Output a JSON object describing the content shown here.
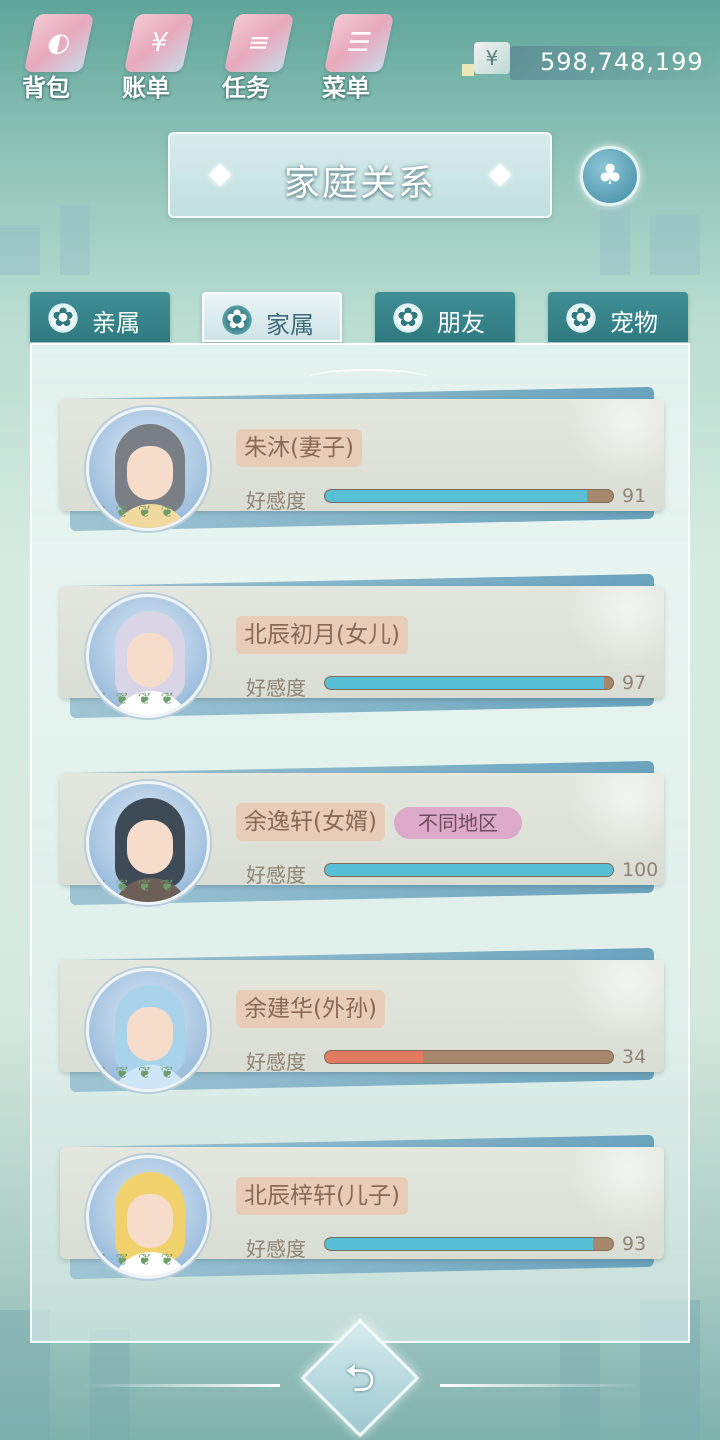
{
  "nav": [
    {
      "label": "背包",
      "icon": "backpack-icon",
      "glyph": "◐"
    },
    {
      "label": "账单",
      "icon": "bill-icon",
      "glyph": "¥"
    },
    {
      "label": "任务",
      "icon": "task-icon",
      "glyph": "≡"
    },
    {
      "label": "菜单",
      "icon": "menu-icon",
      "glyph": "☰"
    }
  ],
  "currency": {
    "symbol": "¥",
    "amount": "598,748,199"
  },
  "title": "家庭关系",
  "tabs": [
    {
      "label": "亲属",
      "active": false
    },
    {
      "label": "家属",
      "active": true
    },
    {
      "label": "朋友",
      "active": false
    },
    {
      "label": "宠物",
      "active": false
    }
  ],
  "affection_label": "好感度",
  "members": [
    {
      "name": "朱沐(妻子)",
      "affection": 91,
      "region_tag": "",
      "hair": "#7a7f86",
      "outfit": "#f1d9a0"
    },
    {
      "name": "北辰初月(女儿)",
      "affection": 97,
      "region_tag": "",
      "hair": "#d9d5e6",
      "outfit": "#ffffff"
    },
    {
      "name": "余逸轩(女婿)",
      "affection": 100,
      "region_tag": "不同地区",
      "hair": "#3f4a57",
      "outfit": "#6d5f57"
    },
    {
      "name": "余建华(外孙)",
      "affection": 34,
      "region_tag": "",
      "hair": "#a9d3ea",
      "outfit": "#cfe6f6"
    },
    {
      "name": "北辰梓轩(儿子)",
      "affection": 93,
      "region_tag": "",
      "hair": "#f0d16b",
      "outfit": "#ffffff"
    }
  ],
  "back_glyph": "⮌"
}
